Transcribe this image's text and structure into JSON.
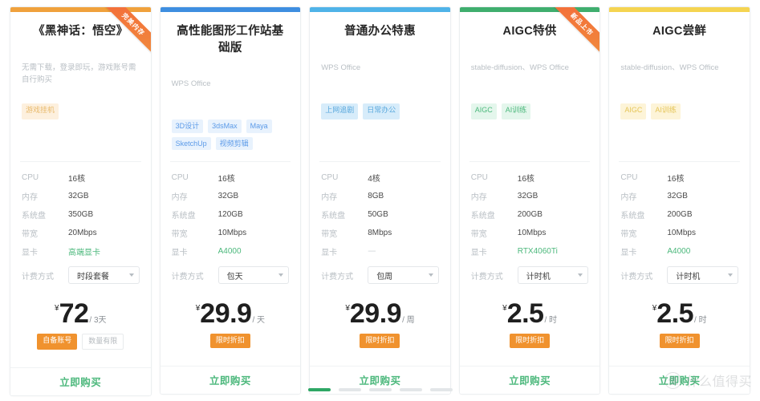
{
  "cards": [
    {
      "topbar_color": "#f0a13c",
      "title": "《黑神话：悟空》",
      "desc": "无需下载，登录即玩，游戏账号需自行购买",
      "tag_style": "orange",
      "tags": [
        "游戏挂机"
      ],
      "ribbon": "完美内存",
      "has_ribbon": true,
      "specs": [
        {
          "label": "CPU",
          "value": "16核",
          "accent": false
        },
        {
          "label": "内存",
          "value": "32GB",
          "accent": false
        },
        {
          "label": "系统盘",
          "value": "350GB",
          "accent": false
        },
        {
          "label": "带宽",
          "value": "20Mbps",
          "accent": false
        },
        {
          "label": "显卡",
          "value": "高端显卡",
          "accent": true
        }
      ],
      "billing_label": "计费方式",
      "billing_value": "时段套餐",
      "currency": "¥",
      "price": "72",
      "unit": "/ 3天",
      "badges": [
        {
          "text": "自备账号",
          "style": "solid"
        },
        {
          "text": "数量有限",
          "style": "ghost"
        }
      ],
      "buy_label": "立即购买"
    },
    {
      "topbar_color": "#3e8ee0",
      "title": "高性能图形工作站基础版",
      "desc": "WPS Office",
      "tag_style": "blue",
      "tags": [
        "3D设计",
        "3dsMax",
        "Maya",
        "SketchUp",
        "视频剪辑"
      ],
      "ribbon": "",
      "has_ribbon": false,
      "specs": [
        {
          "label": "CPU",
          "value": "16核",
          "accent": false
        },
        {
          "label": "内存",
          "value": "32GB",
          "accent": false
        },
        {
          "label": "系统盘",
          "value": "120GB",
          "accent": false
        },
        {
          "label": "带宽",
          "value": "10Mbps",
          "accent": false
        },
        {
          "label": "显卡",
          "value": "A4000",
          "accent": true
        }
      ],
      "billing_label": "计费方式",
      "billing_value": "包天",
      "currency": "¥",
      "price": "29.9",
      "unit": "/ 天",
      "badges": [
        {
          "text": "限时折扣",
          "style": "solid"
        }
      ],
      "buy_label": "立即购买"
    },
    {
      "topbar_color": "#4fb3e8",
      "title": "普通办公特惠",
      "desc": "WPS Office",
      "tag_style": "lblue",
      "tags": [
        "上网追剧",
        "日常办公"
      ],
      "ribbon": "",
      "has_ribbon": false,
      "specs": [
        {
          "label": "CPU",
          "value": "4核",
          "accent": false
        },
        {
          "label": "内存",
          "value": "8GB",
          "accent": false
        },
        {
          "label": "系统盘",
          "value": "50GB",
          "accent": false
        },
        {
          "label": "带宽",
          "value": "8Mbps",
          "accent": false
        },
        {
          "label": "显卡",
          "value": "----",
          "accent": false,
          "dash": true
        }
      ],
      "billing_label": "计费方式",
      "billing_value": "包周",
      "currency": "¥",
      "price": "29.9",
      "unit": "/ 周",
      "badges": [
        {
          "text": "限时折扣",
          "style": "solid"
        }
      ],
      "buy_label": "立即购买"
    },
    {
      "topbar_color": "#3fae6e",
      "title": "AIGC特供",
      "desc": "stable-diffusion、WPS Office",
      "tag_style": "green",
      "tags": [
        "AIGC",
        "AI训练"
      ],
      "ribbon": "新品上市",
      "has_ribbon": true,
      "specs": [
        {
          "label": "CPU",
          "value": "16核",
          "accent": false
        },
        {
          "label": "内存",
          "value": "32GB",
          "accent": false
        },
        {
          "label": "系统盘",
          "value": "200GB",
          "accent": false
        },
        {
          "label": "带宽",
          "value": "10Mbps",
          "accent": false
        },
        {
          "label": "显卡",
          "value": "RTX4060Ti",
          "accent": true
        }
      ],
      "billing_label": "计费方式",
      "billing_value": "计时机",
      "currency": "¥",
      "price": "2.5",
      "unit": "/ 时",
      "badges": [
        {
          "text": "限时折扣",
          "style": "solid"
        }
      ],
      "buy_label": "立即购买"
    },
    {
      "topbar_color": "#f5d451",
      "title": "AIGC尝鲜",
      "desc": "stable-diffusion、WPS Office",
      "tag_style": "yellow",
      "tags": [
        "AIGC",
        "AI训练"
      ],
      "ribbon": "",
      "has_ribbon": false,
      "specs": [
        {
          "label": "CPU",
          "value": "16核",
          "accent": false
        },
        {
          "label": "内存",
          "value": "32GB",
          "accent": false
        },
        {
          "label": "系统盘",
          "value": "200GB",
          "accent": false
        },
        {
          "label": "带宽",
          "value": "10Mbps",
          "accent": false
        },
        {
          "label": "显卡",
          "value": "A4000",
          "accent": true
        }
      ],
      "billing_label": "计费方式",
      "billing_value": "计时机",
      "currency": "¥",
      "price": "2.5",
      "unit": "/ 时",
      "badges": [
        {
          "text": "限时折扣",
          "style": "solid"
        }
      ],
      "buy_label": "立即购买"
    }
  ],
  "pagination": {
    "count": 5,
    "active_index": 0,
    "active_color": "#2ea765"
  },
  "watermark": {
    "logo_glyph": "值",
    "text": "什么值得买"
  }
}
